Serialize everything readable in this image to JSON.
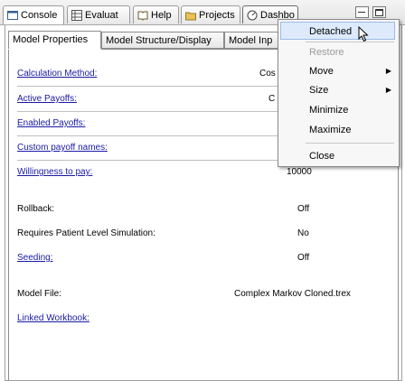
{
  "view_tabs": [
    {
      "label": "Console"
    },
    {
      "label": "Evaluat"
    },
    {
      "label": "Help"
    },
    {
      "label": "Projects"
    },
    {
      "label": "Dashbo"
    }
  ],
  "inner_tabs": [
    {
      "label": "Model Properties"
    },
    {
      "label": "Model Structure/Display"
    },
    {
      "label": "Model Inp"
    }
  ],
  "properties": [
    {
      "label": "Calculation Method:",
      "value": "Cos"
    },
    {
      "label": "Active Payoffs:",
      "value": "C"
    },
    {
      "label": "Enabled Payoffs:",
      "value": ""
    },
    {
      "label": "Custom payoff names:",
      "value": ""
    },
    {
      "label": "Willingness to pay:",
      "value": "10000"
    },
    {
      "label": "Rollback:",
      "value": "Off"
    },
    {
      "label": "Requires Patient Level Simulation:",
      "value": "No"
    },
    {
      "label": "Seeding:",
      "value": "Off"
    },
    {
      "label": "Model File:",
      "value": "Complex Markov Cloned.trex"
    },
    {
      "label": "Linked Workbook:",
      "value": ""
    }
  ],
  "menu": {
    "items": [
      {
        "label": "Detached"
      },
      {
        "label": "Restore"
      },
      {
        "label": "Move"
      },
      {
        "label": "Size"
      },
      {
        "label": "Minimize"
      },
      {
        "label": "Maximize"
      },
      {
        "label": "Close"
      }
    ],
    "submenu_arrow": "▶"
  },
  "colors": {
    "link": "#1a1aa6",
    "menu_highlight": "#dceafc"
  }
}
